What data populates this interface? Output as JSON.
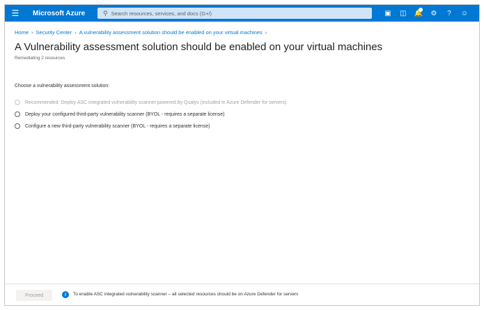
{
  "app": {
    "name": "Microsoft Azure"
  },
  "search": {
    "placeholder": "Search resources, services, and docs (G+/)"
  },
  "breadcrumb": [
    "Home",
    "Security Center",
    "A vulnerability assessment solution should be enabled on your virtual machines"
  ],
  "page": {
    "title": "A Vulnerability assessment solution should be enabled on your virtual machines",
    "subtitle": "Remediating 2 resources",
    "prompt": "Choose a vulnerability assessment solution:"
  },
  "options": [
    {
      "label": "Recommended: Deploy ASC integrated vulnerability scanner powered by Qualys (included in Azure Defender for servers)",
      "disabled": true
    },
    {
      "label": "Deploy your configured third-party vulnerability scanner (BYOL - requires a separate license)",
      "disabled": false
    },
    {
      "label": "Configure a new third-party vulnerability scanner (BYOL - requires a separate license)",
      "disabled": false
    }
  ],
  "footer": {
    "proceed_label": "Proceed",
    "info_text": "To enable ASC integrated vulnerability scanner – all selected resources should be on Azure Defender for servers"
  },
  "colors": {
    "accent": "#0078d4",
    "disabled_text": "#a19f9d"
  }
}
